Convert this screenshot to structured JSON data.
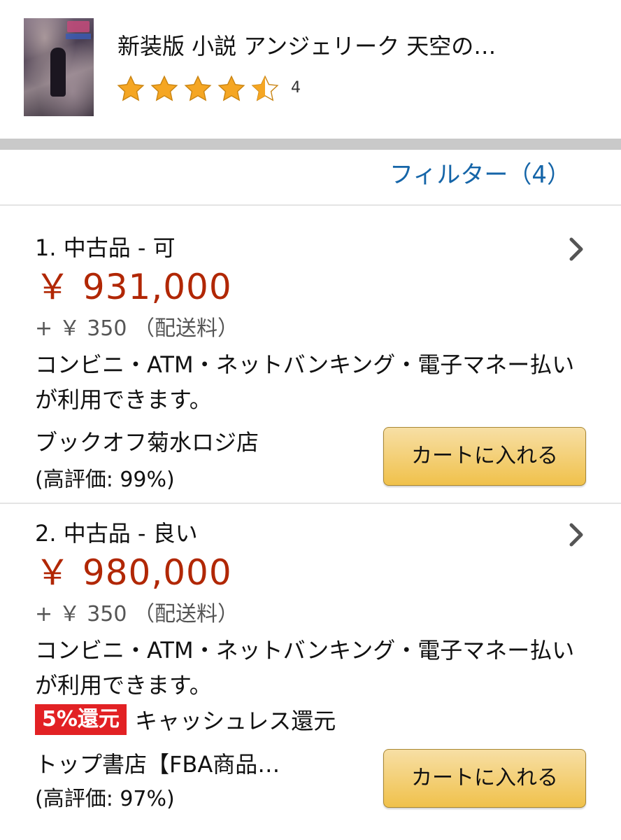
{
  "product": {
    "title": "新装版 小説 アンジェリーク 天空の…",
    "rating_stars": 4.5,
    "review_count": "4"
  },
  "filter": {
    "label": "フィルター（4）"
  },
  "colors": {
    "price": "#b12704",
    "link": "#1565a8",
    "star": "#f5a623",
    "badge": "#e22124",
    "button": "#f0c14b"
  },
  "offers": [
    {
      "condition": "1. 中古品 - 可",
      "price": "￥ 931,000",
      "shipping": "+ ￥ 350 （配送料）",
      "payment": "コンビニ・ATM・ネットバンキング・電子マネー払いが利用できます。",
      "seller": "ブックオフ菊水ロジ店",
      "seller_rating": "(高評価: 99%)",
      "cart_label": "カートに入れる"
    },
    {
      "condition": "2. 中古品 - 良い",
      "price": "￥ 980,000",
      "shipping": "+ ￥ 350 （配送料）",
      "payment": "コンビニ・ATM・ネットバンキング・電子マネー払いが利用できます。",
      "badge": "5%還元",
      "badge_text": "キャッシュレス還元",
      "seller": "トップ書店【FBA商品…",
      "seller_rating": "(高評価: 97%)",
      "cart_label": "カートに入れる"
    }
  ]
}
